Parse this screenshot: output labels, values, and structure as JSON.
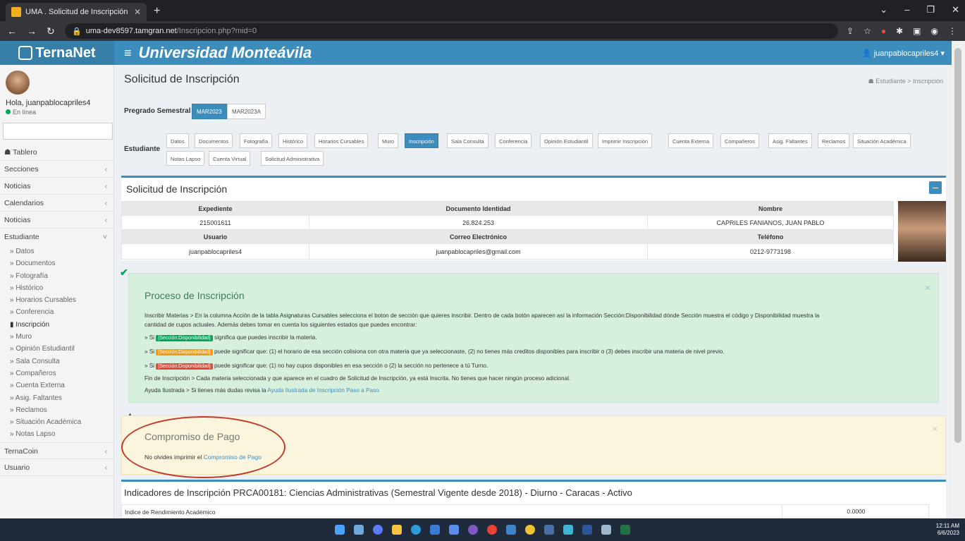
{
  "browser": {
    "tab_title": "UMA . Solicitud de Inscripción",
    "url_host": "uma-dev8597.tamgran.net",
    "url_path": "/Inscripcion.php?mid=0"
  },
  "header": {
    "logo": "TernaNet",
    "university": "Universidad Monteávila",
    "user": "juanpablocapriles4"
  },
  "sidebar": {
    "hello": "Hola, juanpablocapriles4",
    "status": "En línea",
    "items": [
      {
        "label": "Tablero",
        "chevron": ""
      },
      {
        "label": "Secciones",
        "chevron": "‹"
      },
      {
        "label": "Noticias",
        "chevron": "‹"
      },
      {
        "label": "Calendarios",
        "chevron": "‹"
      },
      {
        "label": "Noticias",
        "chevron": "‹"
      },
      {
        "label": "Estudiante",
        "chevron": "˅"
      }
    ],
    "sub_items": [
      "» Datos",
      "» Documentos",
      "» Fotografía",
      "» Histórico",
      "» Horarios Cursables",
      "» Conferencia",
      "▮ Inscripción",
      "» Muro",
      "» Opinión Estudiantil",
      "» Sala Consulta",
      "» Compañeros",
      "» Cuenta Externa",
      "» Asig. Faltantes",
      "» Reclamos",
      "» Situación Académica",
      "» Notas Lapso"
    ],
    "bottom_items": [
      {
        "label": "TernaCoin",
        "chevron": "‹"
      },
      {
        "label": "Usuario",
        "chevron": "‹"
      }
    ]
  },
  "page": {
    "title": "Solicitud de Inscripción",
    "breadcrumb": "Estudiante > Inscripción",
    "program_label": "Pregrado Semestral",
    "periods": [
      "MAR2023",
      "MAR2023A"
    ],
    "student_label": "Estudiante",
    "tabs_row1": [
      "Datos",
      "Documentos",
      "Fotografía",
      "Histórico",
      "Horarios Cursables",
      "Muro",
      "Inscripción",
      "Sala Consulta",
      "Conferencia",
      "Opinión Estudiantil",
      "Imprimir Inscripción",
      "Cuenta Externa",
      "Compañeros",
      "Asig. Faltantes",
      "Reclamos",
      "Situación Académica"
    ],
    "tabs_row2": [
      "Notas Lapso",
      "Cuenta Virtual",
      "Solicitud Administrativa"
    ]
  },
  "info": {
    "box_title": "Solicitud de Inscripción",
    "h_expediente": "Expediente",
    "h_documento": "Documento Identidad",
    "h_nombre": "Nombre",
    "expediente": "215001611",
    "documento": "26.824.253",
    "nombre": "CAPRILES FANIANOS, JUAN PABLO",
    "h_usuario": "Usuario",
    "h_correo": "Correo Electrónico",
    "h_telefono": "Teléfono",
    "usuario": "juanpablocapriles4",
    "correo": "juanpablocapriles@gmail.com",
    "telefono": "0212-9773198"
  },
  "proceso": {
    "title": "Proceso de Inscripción",
    "l1": "Inscribir Materias > En la columna Acción de la tabla Asignaturas Cursables selecciona el boton de sección que quieres inscribir. Dentro de cada botón aparecen así la información Sección:Disponibilidad dónde Sección muestra el código y Disponibilidad muestra la",
    "l2": "cantidad de cupos actuales. Además debes tomar en cuenta los siguientes estados que puedes encontrar:",
    "badge": "[Sección:Disponibilidad]",
    "s_prefix": "» Si",
    "s_green": "significa que puedes inscribir la materia.",
    "s_orange": "puede significar que: (1) el horario de esa sección colisiona con otra materia que ya seleccionaste, (2) no tienes más creditos disponibles para inscribir o (3) debes inscribir una materia de nivel previo.",
    "s_red": "puede significar que: (1) no hay cupos disponibles en esa sección o (2) la sección no pertenece a tú Turno.",
    "fin": "Fin de Inscripción > Cada materia seleccionada y que aparece en el cuadro de Solicitud de Inscripción, ya está Inscrita. No tienes que hacer ningún proceso adicional.",
    "ayuda_pre": "Ayuda Ilustrada > Si tienes más dudas revisa la",
    "ayuda_link": "Ayuda Ilustrada de Inscripción Paso a Paso."
  },
  "pago": {
    "title": "Compromiso de Pago",
    "text": "No olvides imprimir el",
    "link": "Compromiso de Pago"
  },
  "indicadores": {
    "title": "Indicadores de Inscripción PRCA00181: Ciencias Administrativas (Semestral Vigente desde 2018) - Diurno - Caracas - Activo",
    "label": "Indice de Rendimiento Académico",
    "value": "0.0000"
  },
  "taskbar": {
    "time": "12:11 AM",
    "date": "6/6/2023"
  },
  "colors": {
    "primary": "#3c8dbc",
    "green": "#00a65a",
    "orange": "#f39c12",
    "red": "#dd4b39"
  }
}
